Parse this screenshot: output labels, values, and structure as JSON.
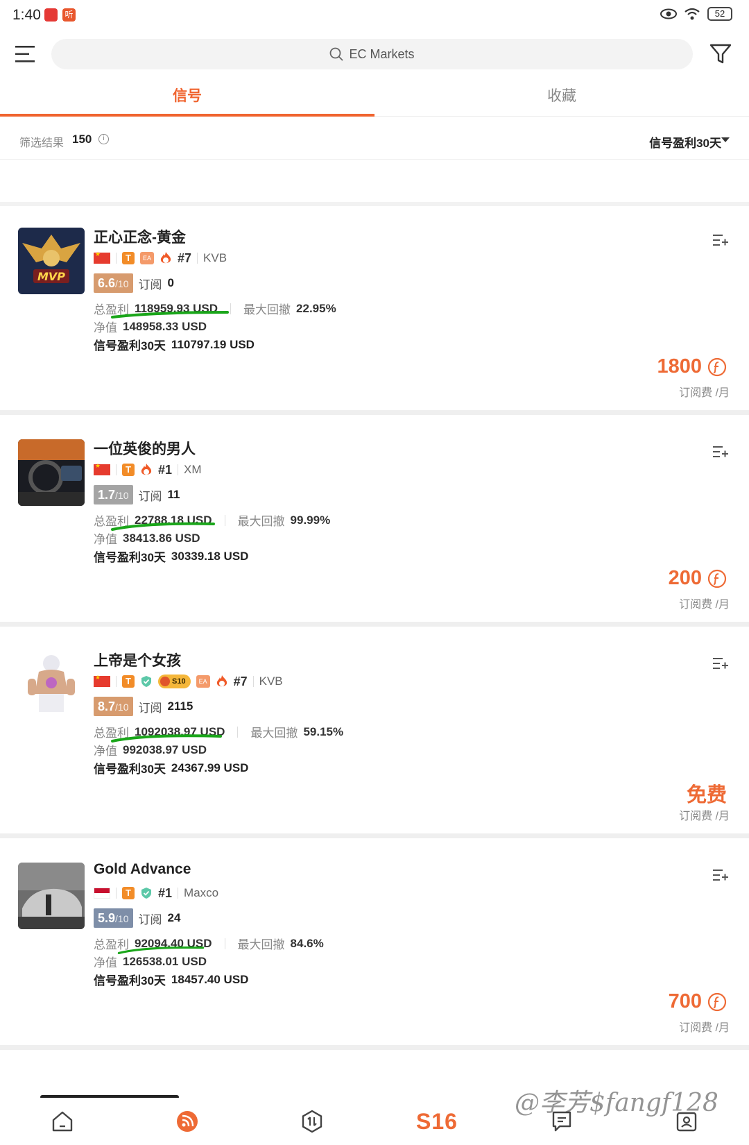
{
  "status": {
    "time": "1:40",
    "app_badge": "听",
    "battery": "52"
  },
  "search": {
    "placeholder": "EC Markets"
  },
  "tabs": [
    {
      "label": "信号",
      "active": true
    },
    {
      "label": "收藏",
      "active": false
    }
  ],
  "filter": {
    "label": "筛选结果",
    "count": "150",
    "sort_label": "信号盈利30天"
  },
  "colors": {
    "accent": "#f0642f",
    "price": "#ee6a35",
    "underline": "#1aa61a"
  },
  "cards": [
    {
      "title": "正心正念-黄金",
      "flag": "CN",
      "rank": "#7",
      "broker": "KVB",
      "score": "6.6",
      "score_den": "/10",
      "subs_label": "订阅",
      "subs": "0",
      "total_profit_label": "总盈利",
      "total_profit": "118959.93 USD",
      "max_dd_label": "最大回撤",
      "max_dd": "22.95%",
      "equity_label": "净值",
      "equity": "148958.33 USD",
      "profit30_label": "信号盈利30天",
      "profit30": "110797.19 USD",
      "price": "1800",
      "price_unit": "订阅费 /月",
      "avatar_text": "MVP"
    },
    {
      "title": "一位英俊的男人",
      "flag": "CN",
      "rank": "#1",
      "broker": "XM",
      "score": "1.7",
      "score_den": "/10",
      "subs_label": "订阅",
      "subs": "11",
      "total_profit_label": "总盈利",
      "total_profit": "22788.18 USD",
      "max_dd_label": "最大回撤",
      "max_dd": "99.99%",
      "equity_label": "净值",
      "equity": "38413.86 USD",
      "profit30_label": "信号盈利30天",
      "profit30": "30339.18 USD",
      "price": "200",
      "price_unit": "订阅费 /月"
    },
    {
      "title": "上帝是个女孩",
      "flag": "CN",
      "rank": "#7",
      "broker": "KVB",
      "season_badge": "S10",
      "score": "8.7",
      "score_den": "/10",
      "subs_label": "订阅",
      "subs": "2115",
      "total_profit_label": "总盈利",
      "total_profit": "1092038.97 USD",
      "max_dd_label": "最大回撤",
      "max_dd": "59.15%",
      "equity_label": "净值",
      "equity": "992038.97 USD",
      "profit30_label": "信号盈利30天",
      "profit30": "24367.99 USD",
      "price": "免费",
      "price_unit": "订阅费 /月"
    },
    {
      "title": "Gold Advance",
      "flag": "ID",
      "rank": "#1",
      "broker": "Maxco",
      "score": "5.9",
      "score_den": "/10",
      "subs_label": "订阅",
      "subs": "24",
      "total_profit_label": "总盈利",
      "total_profit": "92094.40 USD",
      "max_dd_label": "最大回撤",
      "max_dd": "84.6%",
      "equity_label": "净值",
      "equity": "126538.01 USD",
      "profit30_label": "信号盈利30天",
      "profit30": "18457.40 USD",
      "price": "700",
      "price_unit": "订阅费 /月"
    }
  ],
  "bottom_nav": [
    {
      "icon": "home-icon"
    },
    {
      "icon": "signal-feed-icon"
    },
    {
      "icon": "trade-icon"
    },
    {
      "label": "S16"
    },
    {
      "icon": "message-icon"
    },
    {
      "icon": "profile-card-icon"
    }
  ],
  "watermark": "@李芳$fangf128"
}
